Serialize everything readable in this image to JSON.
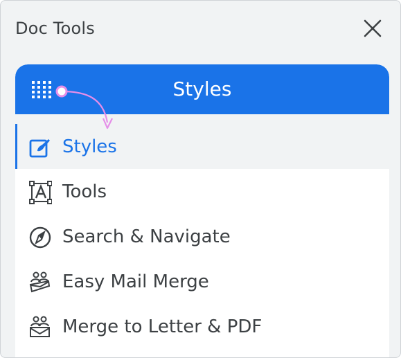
{
  "panel": {
    "title": "Doc Tools",
    "close_icon": "close-icon"
  },
  "menu": {
    "header_title": "Styles",
    "header_icon": "grid-icon",
    "items": [
      {
        "label": "Styles",
        "icon": "edit-square-icon",
        "active": true
      },
      {
        "label": "Tools",
        "icon": "text-frame-icon",
        "active": false
      },
      {
        "label": "Search & Navigate",
        "icon": "compass-icon",
        "active": false
      },
      {
        "label": "Easy Mail Merge",
        "icon": "people-mail-icon",
        "active": false
      },
      {
        "label": "Merge to Letter & PDF",
        "icon": "people-letter-icon",
        "active": false
      }
    ]
  },
  "colors": {
    "accent": "#1a73e8",
    "panel_bg": "#f1f3f4",
    "text": "#3c4043",
    "annotation": "#e58ee8"
  }
}
